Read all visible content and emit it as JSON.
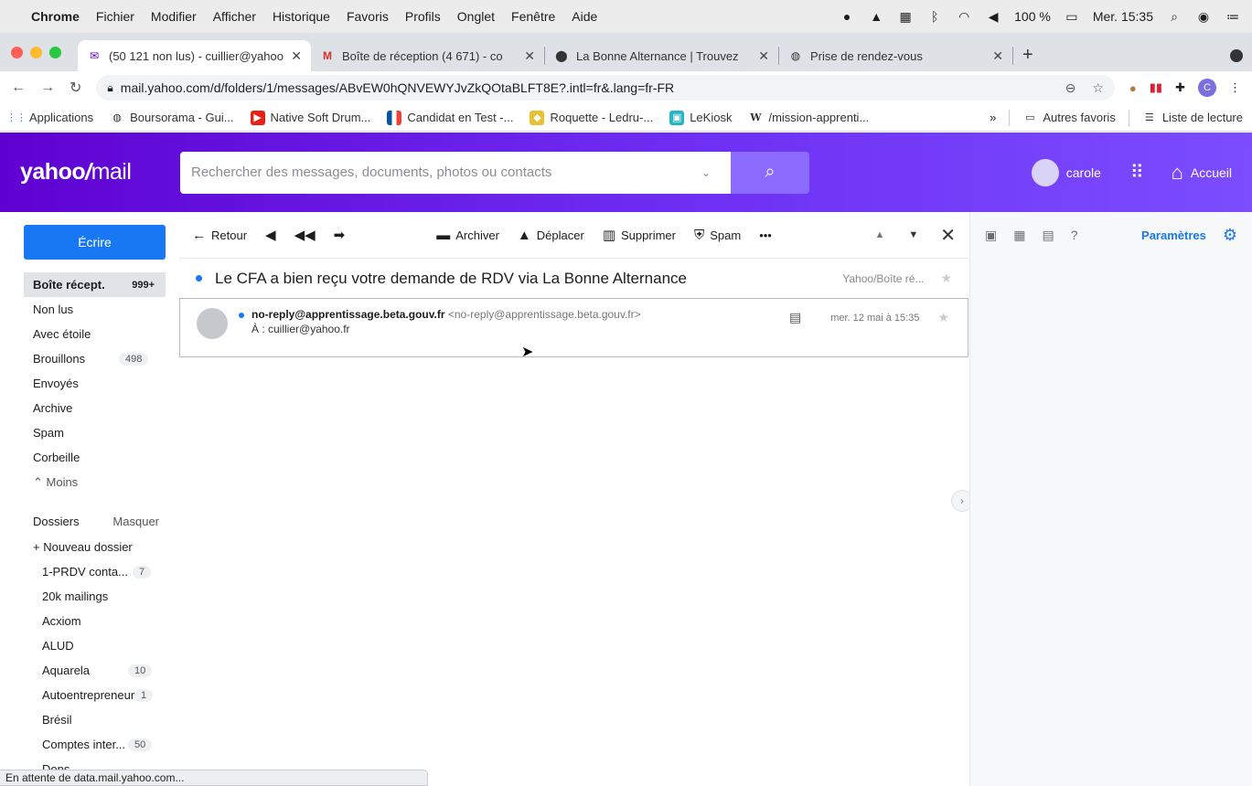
{
  "menubar": {
    "app": "Chrome",
    "items": [
      "Fichier",
      "Modifier",
      "Afficher",
      "Historique",
      "Favoris",
      "Profils",
      "Onglet",
      "Fenêtre",
      "Aide"
    ],
    "battery": "100 %",
    "clock": "Mer. 15:35"
  },
  "tabs": [
    {
      "title": "(50 121 non lus) - cuillier@yahoo",
      "favicon": "envelope-icon",
      "active": true
    },
    {
      "title": "Boîte de réception (4 671) - co",
      "favicon": "gmail-icon"
    },
    {
      "title": "La Bonne Alternance | Trouvez",
      "favicon": "location-pin-icon"
    },
    {
      "title": "Prise de rendez-vous",
      "favicon": "globe-icon"
    }
  ],
  "address": {
    "url": "mail.yahoo.com/d/folders/1/messages/ABvEW0hQNVEWYJvZkQOtaBLFT8E?.intl=fr&.lang=fr-FR"
  },
  "bookmarks": {
    "items": [
      "Applications",
      "Boursorama - Gui...",
      "Native Soft Drum...",
      "Candidat en Test -...",
      "Roquette - Ledru-...",
      "LeKiosk",
      "/mission-apprenti..."
    ],
    "more": "»",
    "other": "Autres favoris",
    "reading": "Liste de lecture"
  },
  "yahoo": {
    "logo_a": "yahoo",
    "logo_b": "/",
    "logo_c": "mail",
    "search_placeholder": "Rechercher des messages, documents, photos ou contacts",
    "user": "carole",
    "home": "Accueil"
  },
  "sidebar": {
    "compose": "Écrire",
    "inbox": "Boîte récept.",
    "inbox_count": "999+",
    "items": [
      {
        "label": "Non lus"
      },
      {
        "label": "Avec étoile"
      },
      {
        "label": "Brouillons",
        "count": "498"
      },
      {
        "label": "Envoyés"
      },
      {
        "label": "Archive"
      },
      {
        "label": "Spam"
      },
      {
        "label": "Corbeille"
      }
    ],
    "less": "⌃ Moins",
    "folders_title": "Dossiers",
    "hide": "Masquer",
    "new_folder": "+  Nouveau dossier",
    "folders": [
      {
        "label": "1-PRDV conta...",
        "count": "7"
      },
      {
        "label": "20k mailings"
      },
      {
        "label": "Acxiom"
      },
      {
        "label": "ALUD"
      },
      {
        "label": "Aquarela",
        "count": "10"
      },
      {
        "label": "Autoentrepreneur",
        "count": "1"
      },
      {
        "label": "Brésil"
      },
      {
        "label": "Comptes inter...",
        "count": "50"
      },
      {
        "label": "Dons"
      }
    ]
  },
  "toolbar": {
    "back": "Retour",
    "archive": "Archiver",
    "move": "Déplacer",
    "delete": "Supprimer",
    "spam": "Spam",
    "more": "•••"
  },
  "message": {
    "subject": "Le CFA a bien reçu votre demande de RDV via La Bonne Alternance",
    "folder": "Yahoo/Boîte ré...",
    "from_name": "no-reply@apprentissage.beta.gouv.fr",
    "from_addr": "<no-reply@apprentissage.beta.gouv.fr>",
    "to": "À : cuillier@yahoo.fr",
    "date": "mer. 12 mai à 15:35"
  },
  "rightrail": {
    "settings": "Paramètres"
  },
  "status": "En attente de data.mail.yahoo.com..."
}
